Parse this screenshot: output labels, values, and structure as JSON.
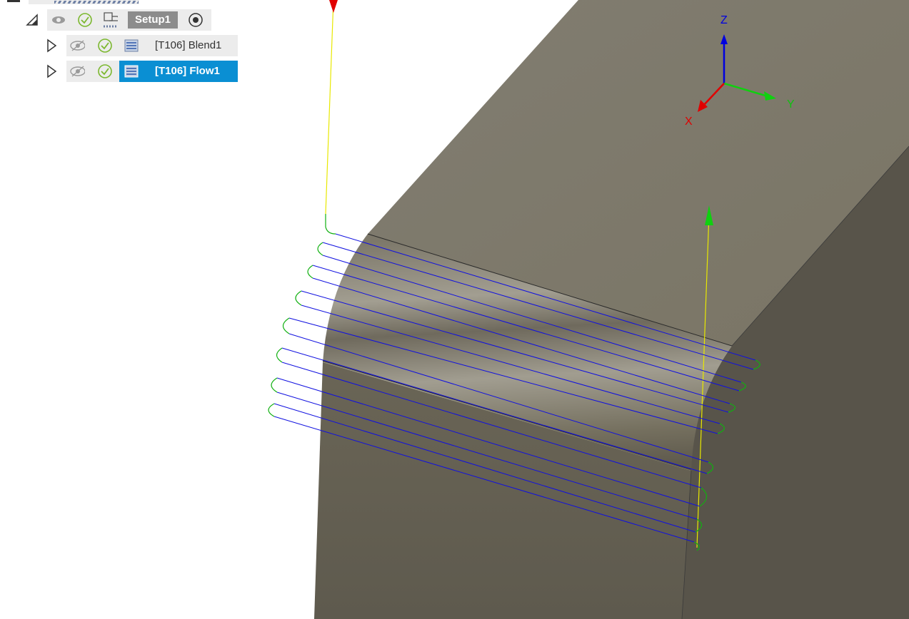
{
  "browser_tree": {
    "setup": {
      "label": "Setup1"
    },
    "operations": [
      {
        "label": "[T106] Blend1",
        "selected": false
      },
      {
        "label": "[T106] Flow1",
        "selected": true
      }
    ]
  },
  "view_cube_axes": {
    "x": "X",
    "y": "Y",
    "z": "Z"
  },
  "colors": {
    "selection": "#0a8fd3",
    "toolpath_cut": "#1010e0",
    "toolpath_link": "#10b010",
    "toolpath_rapid": "#e8e800",
    "model_face": "#7d7869",
    "axis_x": "#e00000",
    "axis_y": "#10d010",
    "axis_z": "#0000e0"
  },
  "icons": [
    "collapse-triangle-icon",
    "eye-icon",
    "eye-hidden-icon",
    "check-circle-icon",
    "setup-fixture-icon",
    "origin-target-icon",
    "toolpath-op-icon"
  ]
}
